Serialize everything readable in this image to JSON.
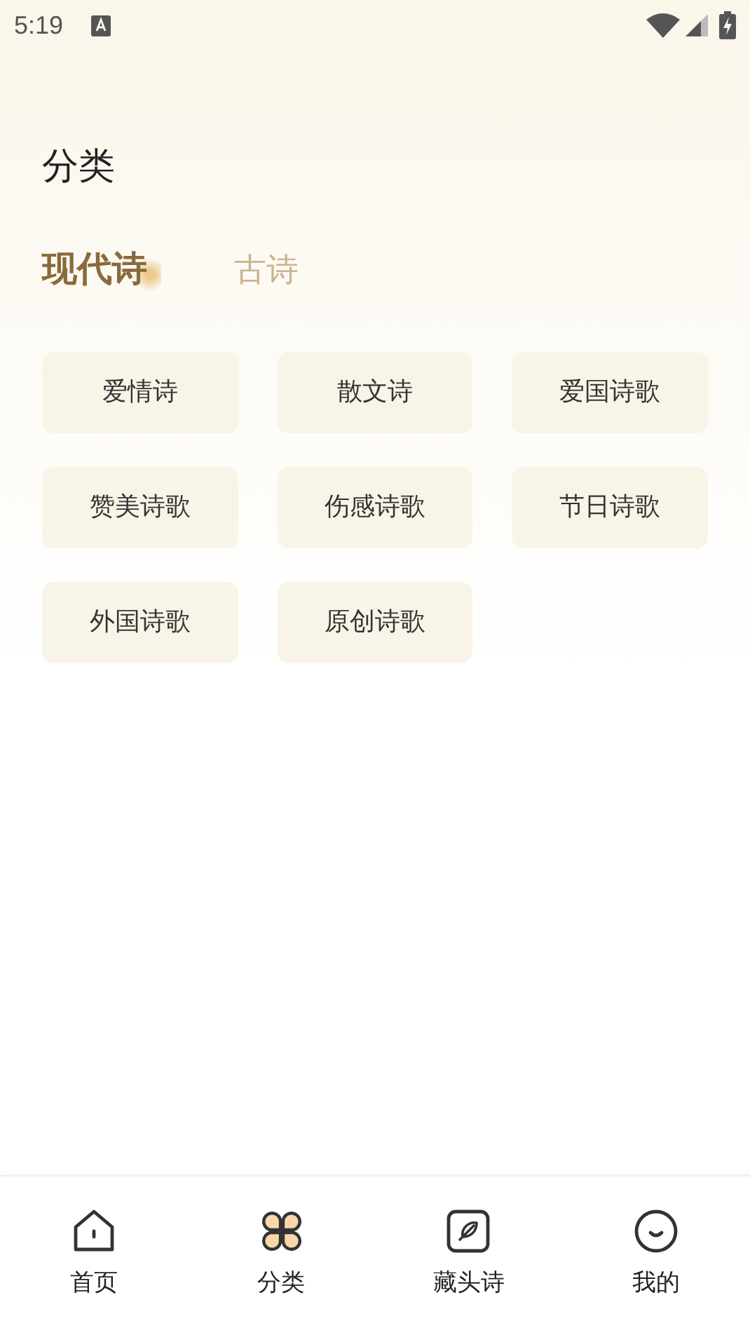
{
  "status_bar": {
    "time": "5:19"
  },
  "page_title": "分类",
  "tabs": [
    {
      "label": "现代诗",
      "selected": true
    },
    {
      "label": "古诗",
      "selected": false
    }
  ],
  "categories": [
    "爱情诗",
    "散文诗",
    "爱国诗歌",
    "赞美诗歌",
    "伤感诗歌",
    "节日诗歌",
    "外国诗歌",
    "原创诗歌"
  ],
  "bottom_nav": [
    {
      "label": "首页",
      "kind": "home",
      "selected": false
    },
    {
      "label": "分类",
      "kind": "clover",
      "selected": true
    },
    {
      "label": "藏头诗",
      "kind": "feather",
      "selected": false
    },
    {
      "label": "我的",
      "kind": "smile",
      "selected": false
    }
  ]
}
